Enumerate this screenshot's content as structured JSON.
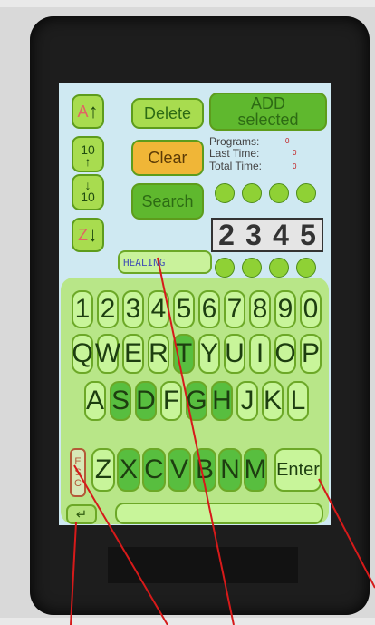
{
  "top_buttons": {
    "delete": "Delete",
    "add_line1": "ADD",
    "add_line2": "selected",
    "clear": "Clear",
    "search": "Search"
  },
  "left_controls": {
    "up_letter": "A",
    "top_value": "10",
    "bottom_value": "10",
    "down_letter": "Z"
  },
  "stats": {
    "programs_label": "Programs:",
    "programs_value": "0",
    "last_time_label": "Last Time:",
    "last_time_value": "0",
    "total_time_label": "Total Time:",
    "total_time_value": "0"
  },
  "digits": [
    "2",
    "3",
    "4",
    "5"
  ],
  "mode_text": "HEALING",
  "keyboard": {
    "row1": [
      "1",
      "2",
      "3",
      "4",
      "5",
      "6",
      "7",
      "8",
      "9",
      "0"
    ],
    "row2": [
      "Q",
      "W",
      "E",
      "R",
      "T",
      "Y",
      "U",
      "I",
      "O",
      "P"
    ],
    "row3": [
      "A",
      "S",
      "D",
      "F",
      "G",
      "H",
      "J",
      "K",
      "L"
    ],
    "row4": [
      "Z",
      "X",
      "C",
      "V",
      "B",
      "N",
      "M"
    ],
    "esc": [
      "E",
      "S",
      "C"
    ],
    "enter": "Enter",
    "return_icon": "↵"
  },
  "colors": {
    "screen_bg": "#cfe9f2",
    "button_green": "#a8dc4f",
    "button_orange": "#f0b637",
    "annotation_red": "#d61a1a"
  }
}
